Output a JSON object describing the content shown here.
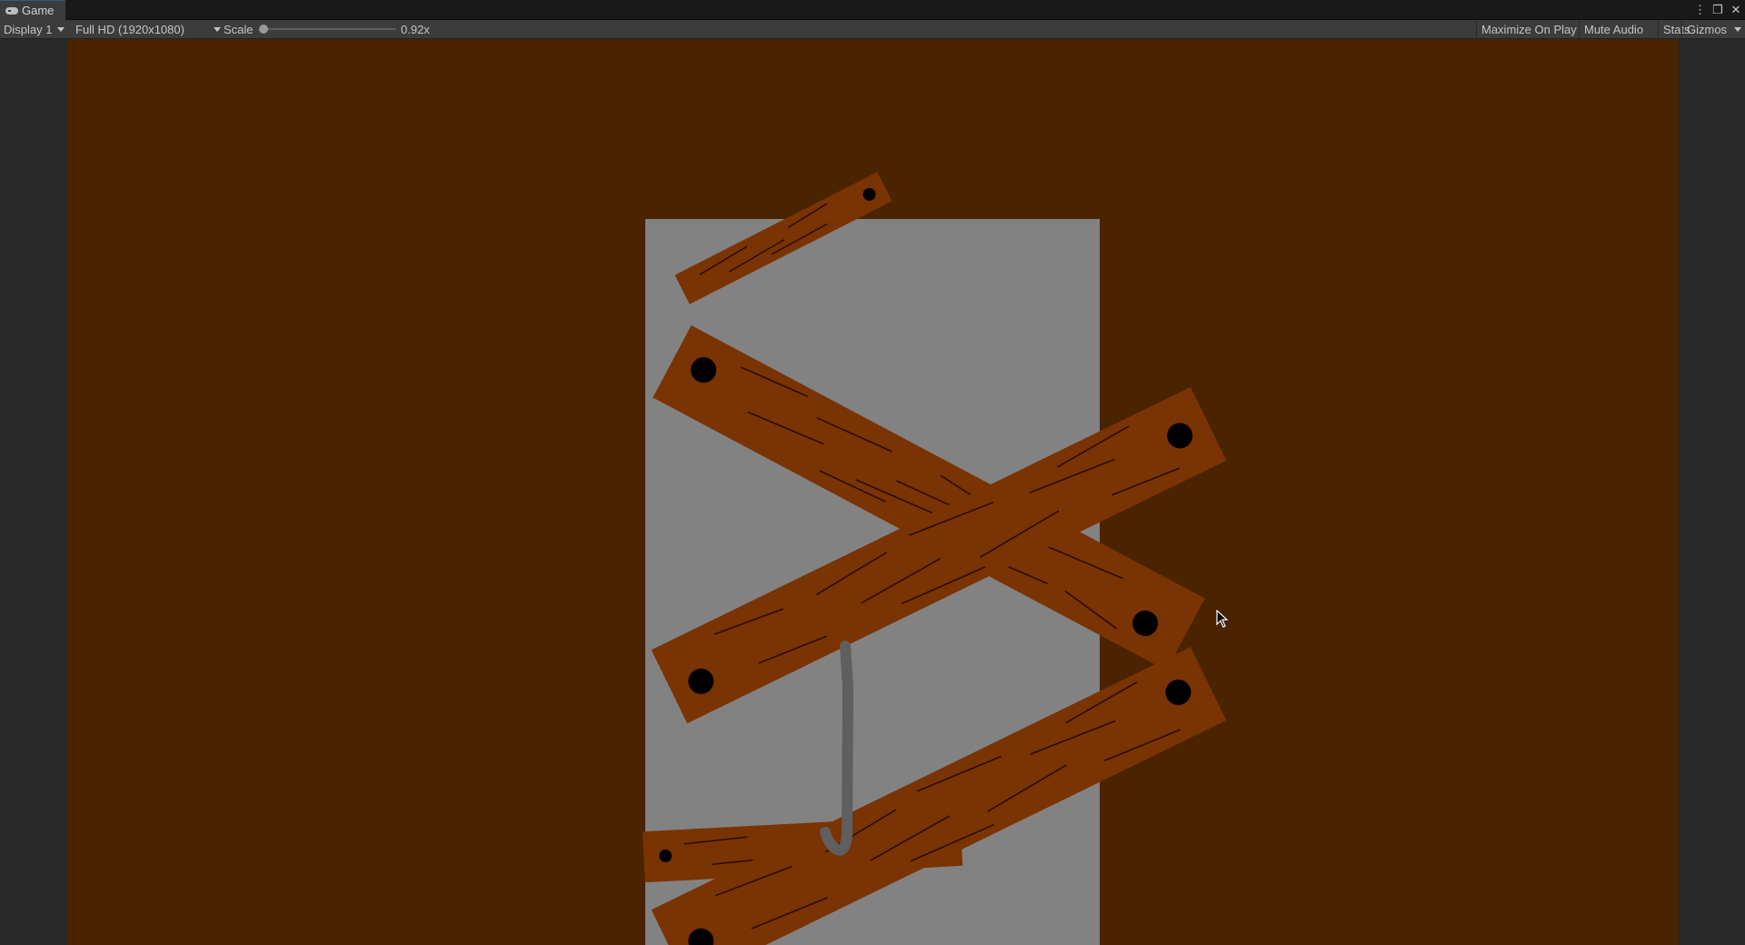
{
  "tab": {
    "title": "Game",
    "icon": "gamepad-icon"
  },
  "window_controls": {
    "more": "⋮",
    "maximize": "❐",
    "close": "✕"
  },
  "toolbar": {
    "display": "Display 1",
    "resolution": "Full HD (1920x1080)",
    "scale_label": "Scale",
    "scale_value": "0.92x",
    "scale_fraction": 0.0,
    "maximize_on_play": "Maximize On Play",
    "mute_audio": "Mute Audio",
    "stats": "Stats",
    "gizmos": "Gizmos"
  },
  "colors": {
    "game_background": "#4a2300",
    "door": "#828282",
    "plank": "#7a3302",
    "nail": "#000000",
    "crowbar": "#5f5f5f"
  }
}
